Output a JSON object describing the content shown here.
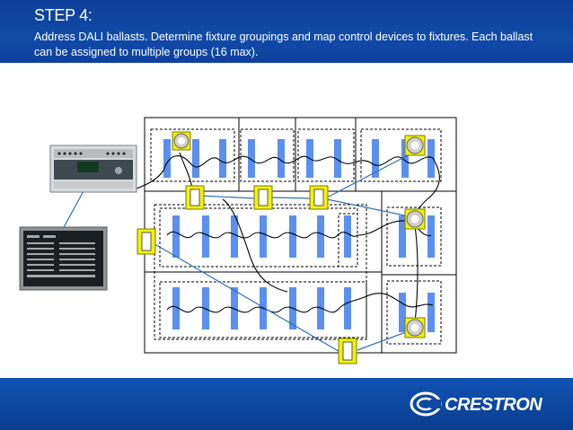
{
  "header": {
    "title": "STEP 4:",
    "subtitle": "Address DALI ballasts. Determine fixture groupings and map control devices to fixtures. Each ballast can be assigned to multiple groups (16 max)."
  },
  "footer": {
    "brand": "CRESTRON",
    "brand_icon": "crestron-swirl-logo"
  },
  "colors": {
    "header_bg": "#114aa8",
    "footer_bg": "#0e4aa6",
    "fixture": "#5b8ff0",
    "control_highlight": "#f2f20a",
    "wire": "#2f6fb5"
  },
  "devices": {
    "controller": "dali-controller-unit",
    "touchpanel": "touchpanel-screen",
    "sensor": "occupancy-sensor-icon",
    "switch": "wall-switch-icon"
  }
}
